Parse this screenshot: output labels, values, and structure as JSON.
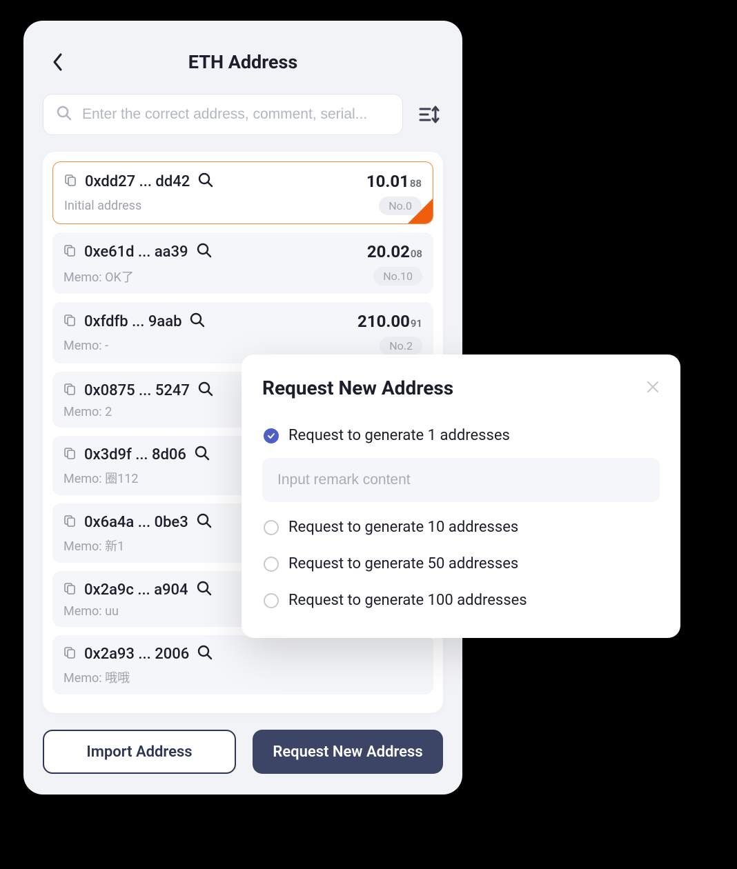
{
  "header": {
    "title": "ETH Address"
  },
  "search": {
    "placeholder": "Enter the correct address, comment, serial..."
  },
  "addresses": [
    {
      "addr": "0xdd27 ... dd42",
      "balance_main": "10.01",
      "balance_frac": "88",
      "memo": "Initial address",
      "badge": "No.0",
      "selected": true
    },
    {
      "addr": "0xe61d ... aa39",
      "balance_main": "20.02",
      "balance_frac": "08",
      "memo": "Memo: OK了",
      "badge": "No.10",
      "selected": false
    },
    {
      "addr": "0xfdfb ... 9aab",
      "balance_main": "210.00",
      "balance_frac": "91",
      "memo": "Memo: -",
      "badge": "No.2",
      "selected": false
    },
    {
      "addr": "0x0875 ... 5247",
      "balance_main": "",
      "balance_frac": "",
      "memo": "Memo: 2",
      "badge": "",
      "selected": false
    },
    {
      "addr": "0x3d9f ... 8d06",
      "balance_main": "",
      "balance_frac": "",
      "memo": "Memo: 圈112",
      "badge": "",
      "selected": false
    },
    {
      "addr": "0x6a4a ... 0be3",
      "balance_main": "",
      "balance_frac": "",
      "memo": "Memo: 新1",
      "badge": "",
      "selected": false
    },
    {
      "addr": "0x2a9c ... a904",
      "balance_main": "",
      "balance_frac": "",
      "memo": "Memo: uu",
      "badge": "",
      "selected": false
    },
    {
      "addr": "0x2a93 ... 2006",
      "balance_main": "",
      "balance_frac": "",
      "memo": "Memo: 哦哦",
      "badge": "",
      "selected": false
    }
  ],
  "footer": {
    "import_label": "Import Address",
    "request_label": "Request New Address"
  },
  "modal": {
    "title": "Request New Address",
    "remark_placeholder": "Input remark content",
    "options": [
      {
        "label": "Request to generate 1 addresses",
        "checked": true
      },
      {
        "label": "Request to generate 10 addresses",
        "checked": false
      },
      {
        "label": "Request to generate 50 addresses",
        "checked": false
      },
      {
        "label": "Request to generate 100 addresses",
        "checked": false
      }
    ]
  }
}
